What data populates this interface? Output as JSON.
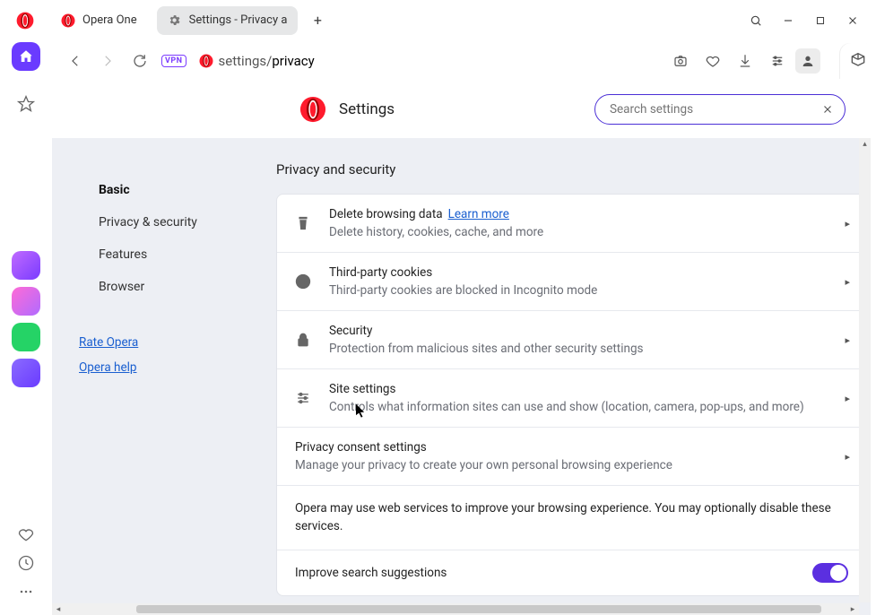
{
  "window": {
    "tab_inactive": "Opera One",
    "tab_active": "Settings - Privacy a"
  },
  "toolbar": {
    "vpn": "VPN",
    "url_seg1": "settings",
    "url_seg2": "privacy"
  },
  "settings": {
    "title": "Settings",
    "search_placeholder": "Search settings"
  },
  "nav": {
    "basic": "Basic",
    "privacy": "Privacy & security",
    "features": "Features",
    "browser": "Browser",
    "rate": "Rate Opera",
    "help": "Opera help"
  },
  "section": {
    "heading": "Privacy and security",
    "rows": [
      {
        "title": "Delete browsing data",
        "link": "Learn more",
        "desc": "Delete history, cookies, cache, and more"
      },
      {
        "title": "Third-party cookies",
        "desc": "Third-party cookies are blocked in Incognito mode"
      },
      {
        "title": "Security",
        "desc": "Protection from malicious sites and other security settings"
      },
      {
        "title": "Site settings",
        "desc": "Controls what information sites can use and show (location, camera, pop-ups, and more)"
      },
      {
        "title": "Privacy consent settings",
        "desc": "Manage your privacy to create your own personal browsing experience"
      }
    ],
    "note": "Opera may use web services to improve your browsing experience. You may optionally disable these services.",
    "toggle": "Improve search suggestions"
  }
}
